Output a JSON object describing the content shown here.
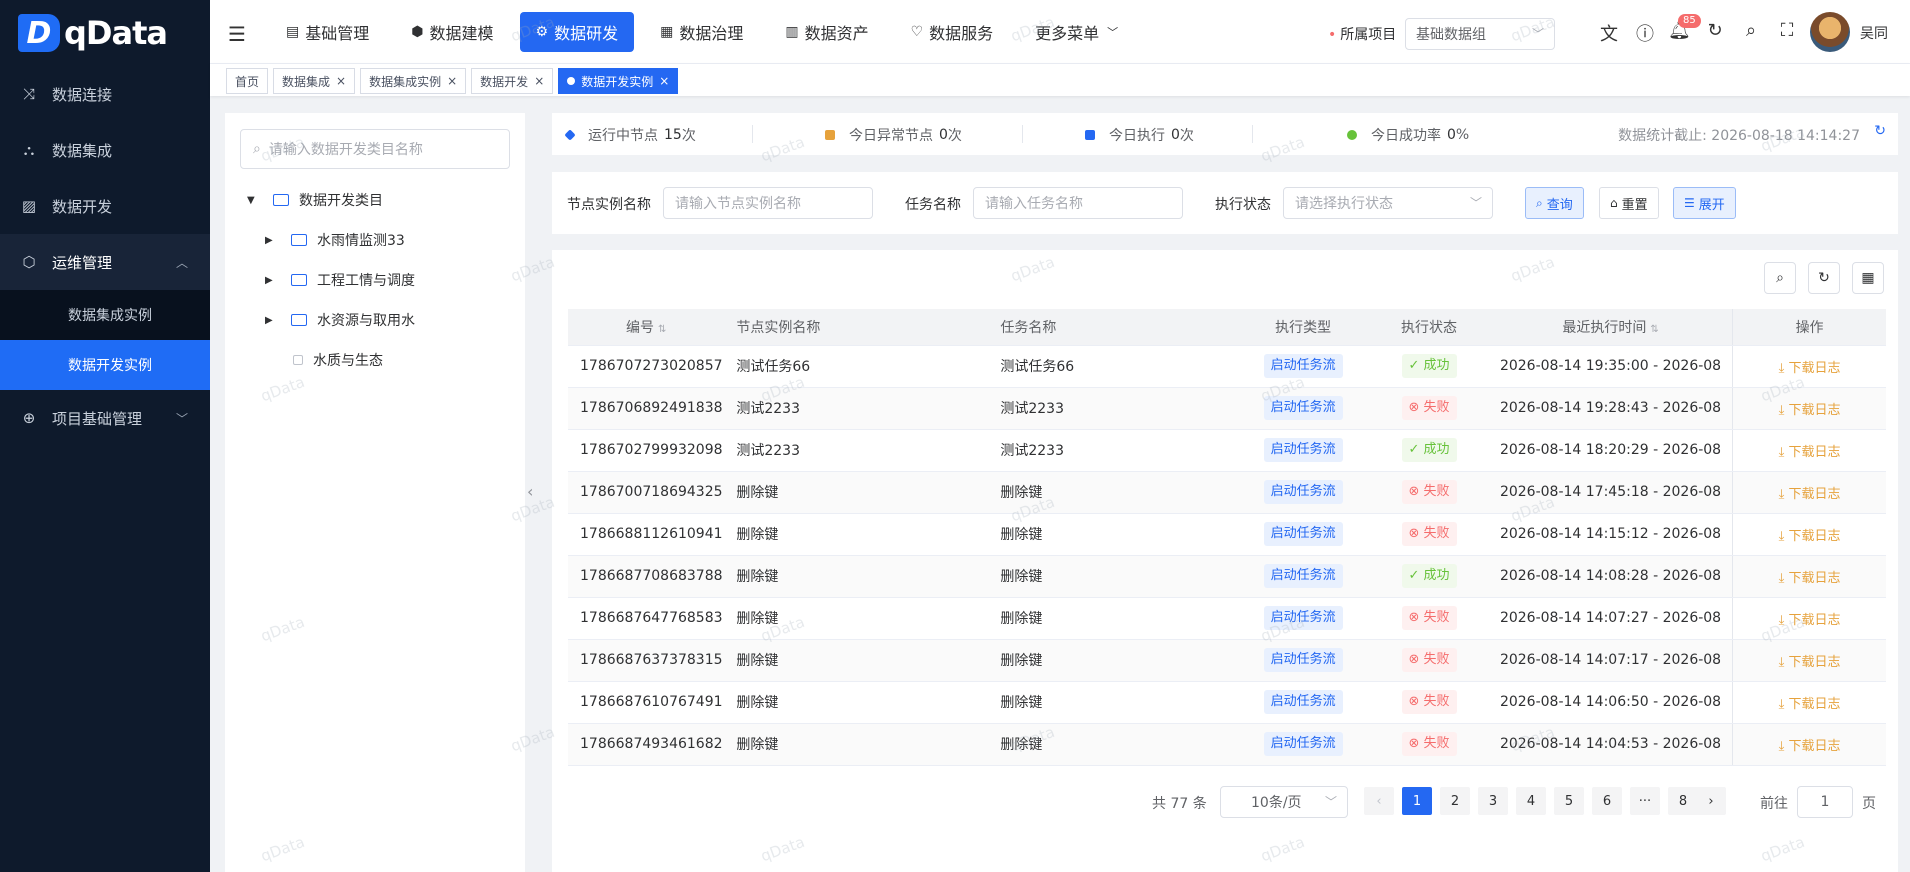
{
  "logo": {
    "mark": "D",
    "text": "qData"
  },
  "sidebar": {
    "items": [
      {
        "label": "数据连接",
        "icon": "shuffle-icon"
      },
      {
        "label": "数据集成",
        "icon": "nodes-icon"
      },
      {
        "label": "数据开发",
        "icon": "chart-icon"
      },
      {
        "label": "运维管理",
        "icon": "box-icon"
      },
      {
        "label": "项目基础管理",
        "icon": "globe-icon"
      }
    ],
    "sub_items": [
      "数据集成实例",
      "数据开发实例"
    ]
  },
  "topnav": {
    "items": [
      "基础管理",
      "数据建模",
      "数据研发",
      "数据治理",
      "数据资产",
      "数据服务",
      "更多菜单"
    ],
    "project_label": "所属项目",
    "project_value": "基础数据组",
    "badge": "85",
    "username": "吴同"
  },
  "tabs": [
    "首页",
    "数据集成",
    "数据集成实例",
    "数据开发",
    "数据开发实例"
  ],
  "tree": {
    "search_placeholder": "请输入数据开发类目名称",
    "root": "数据开发类目",
    "children": [
      "水雨情监测33",
      "工程工情与调度",
      "水资源与取用水",
      "水质与生态"
    ]
  },
  "stats": {
    "running_label": "运行中节点",
    "running_value": "15",
    "abnormal_label": "今日异常节点",
    "abnormal_value": "0",
    "exec_label": "今日执行",
    "exec_value": "0",
    "success_label": "今日成功率",
    "success_value": "0",
    "unit_times": "次",
    "unit_pct": "%",
    "updated_label": "数据统计截止:",
    "updated_value": "2026-08-18 14:14:27",
    "colors": {
      "running": "#2468f2",
      "abnormal": "#e6a23c",
      "exec": "#2468f2",
      "success": "#67c23a"
    }
  },
  "filter": {
    "node_label": "节点实例名称",
    "node_placeholder": "请输入节点实例名称",
    "task_label": "任务名称",
    "task_placeholder": "请输入任务名称",
    "status_label": "执行状态",
    "status_placeholder": "请选择执行状态",
    "query": "查询",
    "reset": "重置",
    "expand": "展开"
  },
  "table": {
    "headers": [
      "编号",
      "节点实例名称",
      "任务名称",
      "执行类型",
      "执行状态",
      "最近执行时间",
      "操作"
    ],
    "rows": [
      [
        "1786707273020857",
        "测试任务66",
        "测试任务66",
        "启动任务流",
        "成功",
        "2026-08-14 19:35:00  -  2026-08"
      ],
      [
        "1786706892491838",
        "测试2233",
        "测试2233",
        "启动任务流",
        "失败",
        "2026-08-14 19:28:43  -  2026-08"
      ],
      [
        "1786702799932098",
        "测试2233",
        "测试2233",
        "启动任务流",
        "成功",
        "2026-08-14 18:20:29  -  2026-08"
      ],
      [
        "1786700718694325",
        "删除键",
        "删除键",
        "启动任务流",
        "失败",
        "2026-08-14 17:45:18  -  2026-08"
      ],
      [
        "1786688112610941",
        "删除键",
        "删除键",
        "启动任务流",
        "失败",
        "2026-08-14 14:15:12  -  2026-08"
      ],
      [
        "1786687708683788",
        "删除键",
        "删除键",
        "启动任务流",
        "成功",
        "2026-08-14 14:08:28  -  2026-08"
      ],
      [
        "1786687647768583",
        "删除键",
        "删除键",
        "启动任务流",
        "失败",
        "2026-08-14 14:07:27  -  2026-08"
      ],
      [
        "1786687637378315",
        "删除键",
        "删除键",
        "启动任务流",
        "失败",
        "2026-08-14 14:07:17  -  2026-08"
      ],
      [
        "1786687610767491",
        "删除键",
        "删除键",
        "启动任务流",
        "失败",
        "2026-08-14 14:06:50  -  2026-08"
      ],
      [
        "1786687493461682",
        "删除键",
        "删除键",
        "启动任务流",
        "失败",
        "2026-08-14 14:04:53  -  2026-08"
      ]
    ],
    "action": "下载日志",
    "status_ok": "成功"
  },
  "pagination": {
    "total": "共 77 条",
    "page_size": "10条/页",
    "pages": [
      "1",
      "2",
      "3",
      "4",
      "5",
      "6",
      "···",
      "8"
    ],
    "current": "1",
    "goto_label": "前往",
    "goto_value": "1",
    "goto_unit": "页"
  },
  "watermark": "qData"
}
